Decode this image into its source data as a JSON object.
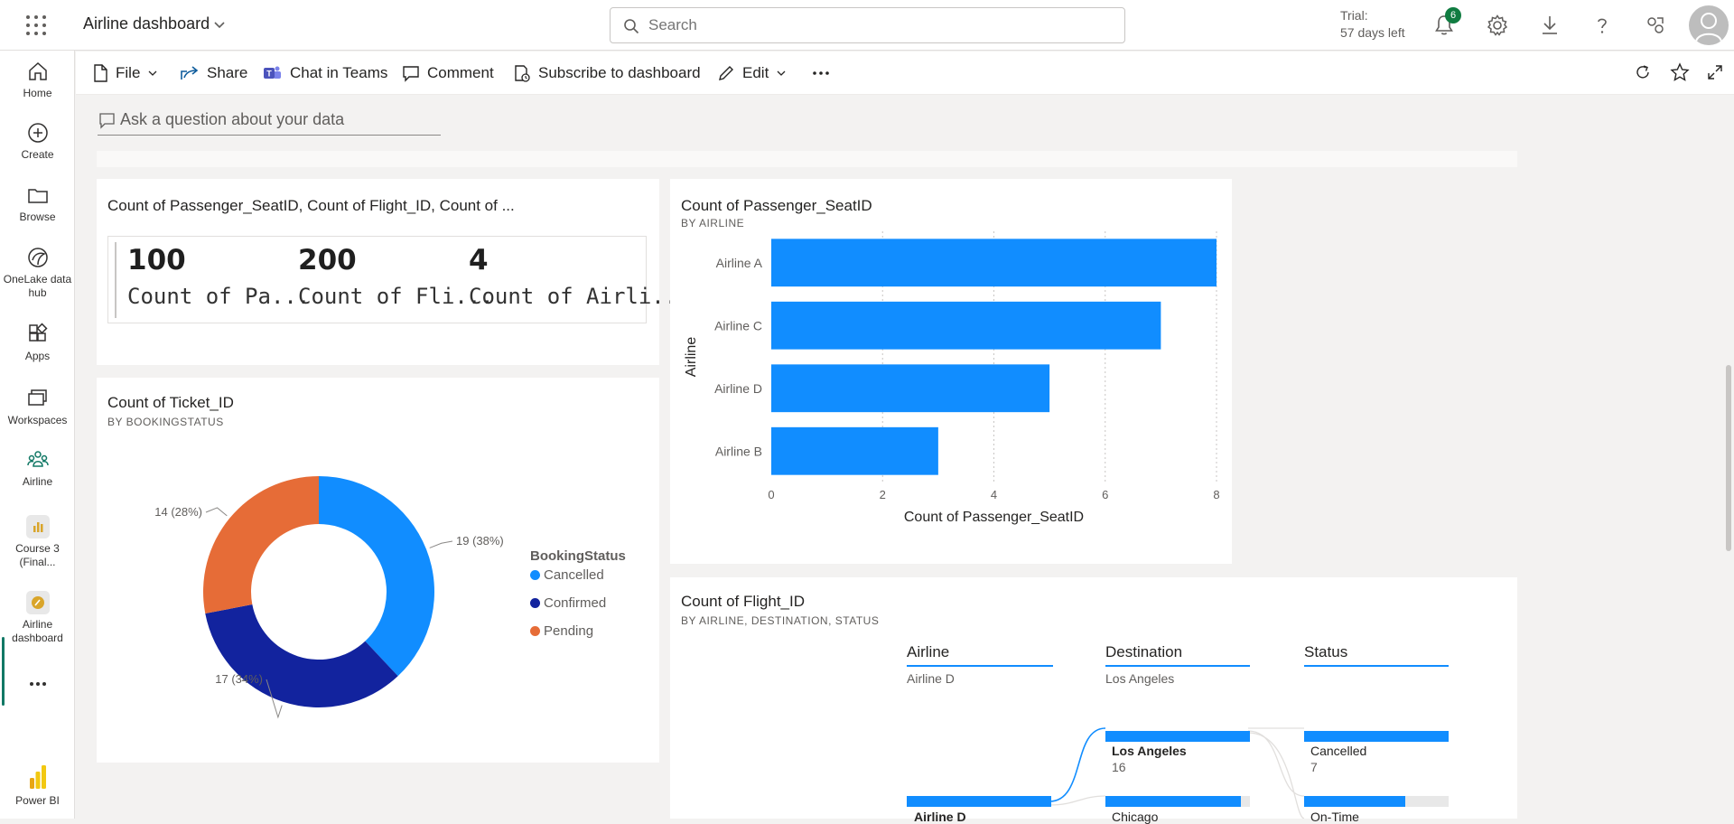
{
  "header": {
    "app_title": "Airline dashboard",
    "search_placeholder": "Search",
    "trial_line1": "Trial:",
    "trial_line2": "57 days left",
    "notification_count": "6"
  },
  "nav": [
    {
      "label": "Home",
      "icon": "home-icon"
    },
    {
      "label": "Create",
      "icon": "plus-circle-icon"
    },
    {
      "label": "Browse",
      "icon": "folder-icon"
    },
    {
      "label": "OneLake data hub",
      "icon": "onelake-icon"
    },
    {
      "label": "Apps",
      "icon": "apps-icon"
    },
    {
      "label": "Workspaces",
      "icon": "workspaces-icon"
    },
    {
      "label": "Airline",
      "icon": "people-icon"
    },
    {
      "label": "Course 3 (Final...",
      "icon": "report-icon"
    },
    {
      "label": "Airline dashboard",
      "icon": "dashboard-icon"
    },
    {
      "label": "Power BI",
      "icon": "powerbi-logo"
    }
  ],
  "actions": {
    "file": "File",
    "share": "Share",
    "chat": "Chat in Teams",
    "comment": "Comment",
    "subscribe": "Subscribe to dashboard",
    "edit": "Edit"
  },
  "qa_placeholder": "Ask a question about your data",
  "cards_tile": {
    "title": "Count of Passenger_SeatID, Count of Flight_ID, Count of ...",
    "kpis": [
      {
        "value": "100",
        "label": "Count of Pa..."
      },
      {
        "value": "200",
        "label": "Count of Fli..."
      },
      {
        "value": "4",
        "label": "Count of Airli..."
      }
    ]
  },
  "donut_tile": {
    "title": "Count of Ticket_ID",
    "subtitle": "BY BOOKINGSTATUS",
    "legend_title": "BookingStatus",
    "labels": [
      "19 (38%)",
      "17 (34%)",
      "14 (28%)"
    ]
  },
  "bar_tile": {
    "title": "Count of Passenger_SeatID",
    "subtitle": "BY AIRLINE"
  },
  "tree_tile": {
    "title": "Count of Flight_ID",
    "subtitle": "BY AIRLINE, DESTINATION, STATUS",
    "columns": [
      {
        "header": "Airline",
        "value": "Airline D"
      },
      {
        "header": "Destination",
        "value": "Los Angeles"
      },
      {
        "header": "Status",
        "value": ""
      }
    ],
    "nodes": {
      "dest_top_label": "Los Angeles",
      "dest_top_value": "16",
      "status_top_label": "Cancelled",
      "status_top_value": "7",
      "airline_partial": "Airline D",
      "dest_partial": "Chicago",
      "status_partial": "On-Time"
    }
  },
  "chart_data": [
    {
      "type": "pie",
      "title": "Count of Ticket_ID",
      "subtitle": "BY BOOKINGSTATUS",
      "legend_title": "BookingStatus",
      "legend": "right",
      "categories": [
        "Cancelled",
        "Confirmed",
        "Pending"
      ],
      "values": [
        19,
        17,
        14
      ],
      "percent": [
        38,
        34,
        28
      ],
      "colors": [
        "#118dff",
        "#12239e",
        "#e66c37"
      ],
      "donut": true
    },
    {
      "type": "bar",
      "orientation": "horizontal",
      "title": "Count of Passenger_SeatID",
      "subtitle": "BY AIRLINE",
      "categories": [
        "Airline A",
        "Airline C",
        "Airline D",
        "Airline B"
      ],
      "values": [
        8,
        7,
        5,
        3
      ],
      "xlabel": "Count of Passenger_SeatID",
      "ylabel": "Airline",
      "xlim": [
        0,
        8
      ],
      "xticks": [
        "0",
        "2",
        "4",
        "6",
        "8"
      ],
      "grid": true,
      "color": "#118dff"
    }
  ]
}
